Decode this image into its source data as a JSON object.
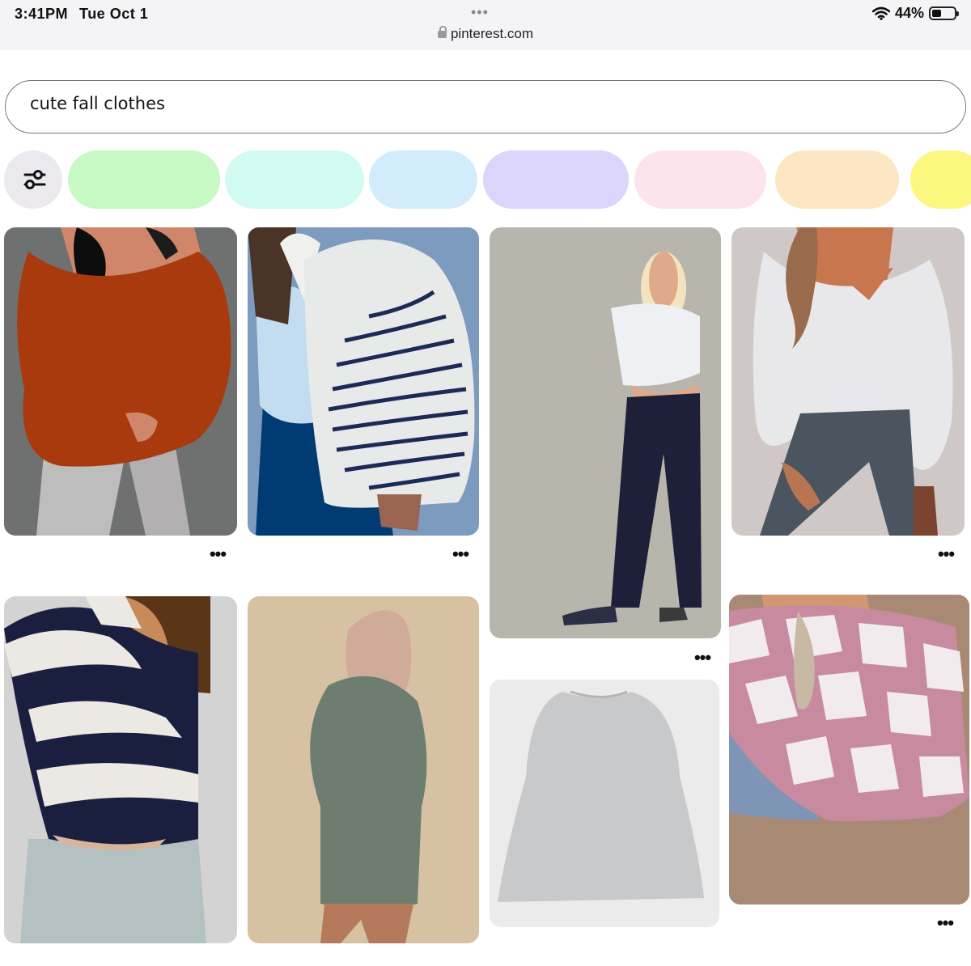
{
  "status_bar": {
    "time": "3:41PM",
    "date": "Tue Oct 1",
    "url": "pinterest.com",
    "battery": "44%",
    "battery_level": 0.44,
    "dots": "•••"
  },
  "search": {
    "value": "cute fall clothes"
  },
  "filter_chips": [
    {
      "color": "#c6f9c4"
    },
    {
      "color": "#d1fbf2"
    },
    {
      "color": "#d3ecfb"
    },
    {
      "color": "#dcd5fb"
    },
    {
      "color": "#fde4ec"
    },
    {
      "color": "#fde6c4"
    },
    {
      "color": "#fcf77e"
    }
  ],
  "pins": [
    {
      "name": "rust-off-shoulder-sweater",
      "bg": "#6f7170"
    },
    {
      "name": "striped-cardigan",
      "bg": "#7d9bbf"
    },
    {
      "name": "white-tee-navy-trousers",
      "bg": "#b8b5ad"
    },
    {
      "name": "white-blouse-dark-jeans",
      "bg": "#cfc8c6"
    },
    {
      "name": "navy-white-striped-sweater",
      "bg": "#d3d3d3"
    },
    {
      "name": "green-sweater-dress",
      "bg": "#d6c2a2"
    },
    {
      "name": "gray-oversized-sweatshirt",
      "bg": "#ebebeb"
    },
    {
      "name": "pink-checkered-sweater",
      "bg": "#a88a74"
    }
  ],
  "more_label": "•••"
}
